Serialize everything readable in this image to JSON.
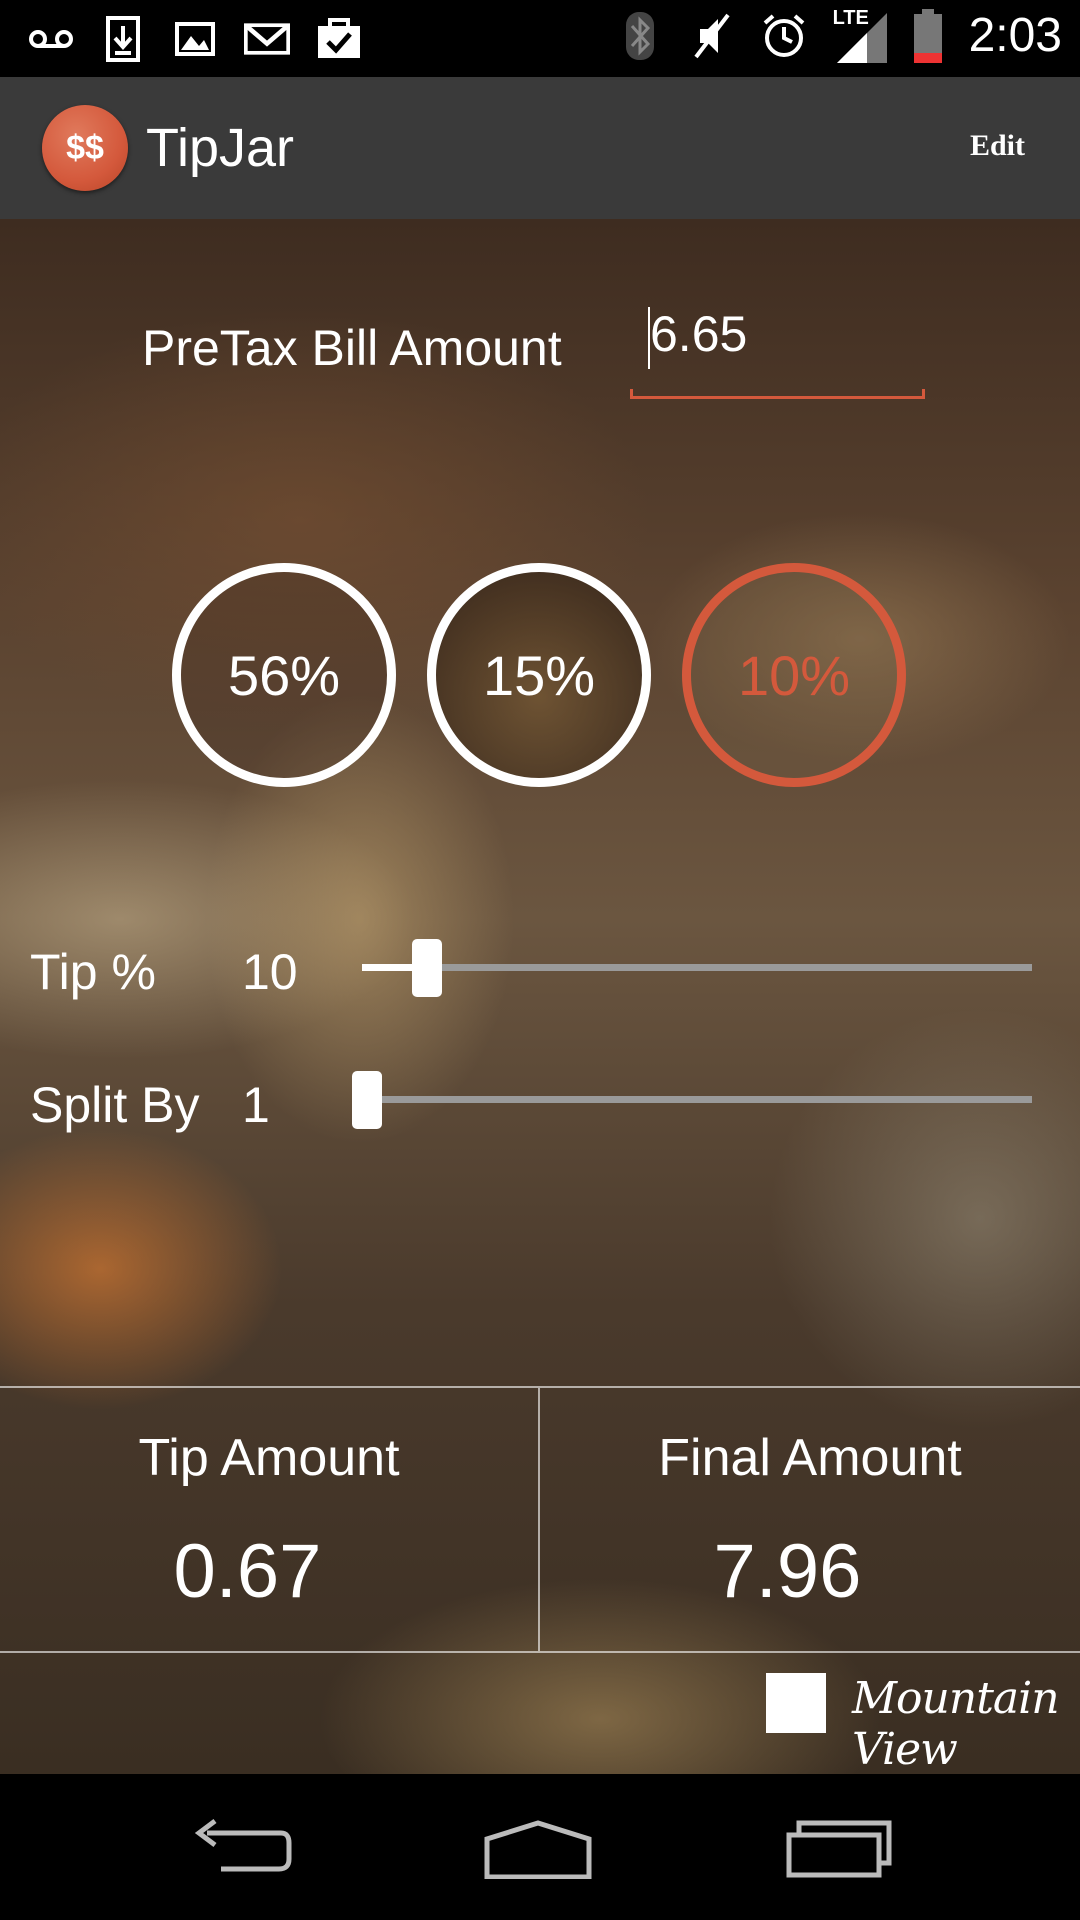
{
  "status_bar": {
    "time": "2:03",
    "network": "LTE",
    "left_icons": [
      "voicemail-icon",
      "download-icon",
      "image-icon",
      "gmail-icon",
      "clipboard-check-icon"
    ],
    "right_icons": [
      "bluetooth-icon",
      "mute-icon",
      "alarm-icon",
      "signal-icon",
      "battery-icon"
    ]
  },
  "action_bar": {
    "logo_text": "$$",
    "title": "TipJar",
    "edit_label": "Edit"
  },
  "bill": {
    "label": "PreTax Bill Amount",
    "value": "6.65"
  },
  "presets": [
    {
      "label": "56%",
      "selected": false
    },
    {
      "label": "15%",
      "selected": false
    },
    {
      "label": "10%",
      "selected": true
    }
  ],
  "tip": {
    "label": "Tip %",
    "value": "10"
  },
  "split": {
    "label": "Split By",
    "value": "1"
  },
  "results": {
    "tip_label": "Tip Amount",
    "tip_value": "0.67",
    "final_label": "Final Amount",
    "final_value": "7.96"
  },
  "location": {
    "label": "Mountain View",
    "checked": false
  },
  "colors": {
    "accent": "#d4593c",
    "action_bar": "#3a3a3a"
  }
}
